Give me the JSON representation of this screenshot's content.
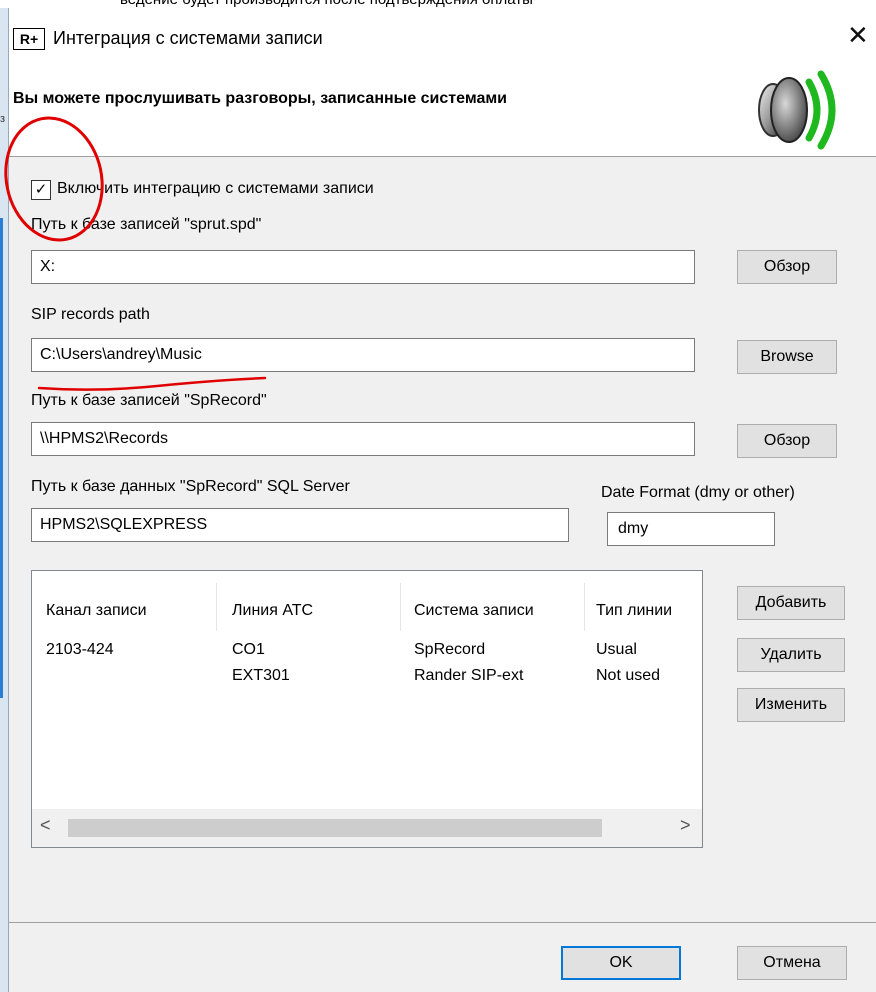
{
  "background_text": "ведение будет производится после подтверждения оплаты",
  "window": {
    "app_icon_text": "R+",
    "title": "Интеграция с системами записи",
    "close_glyph": "✕"
  },
  "banner": {
    "text": "Вы можете прослушивать разговоры, записанные системами"
  },
  "integration_checkbox": {
    "checked": true,
    "check_glyph": "✓",
    "label": "Включить интеграцию с системами записи"
  },
  "sprut": {
    "label": "Путь к базе записей \"sprut.spd\"",
    "value": "X:",
    "button": "Обзор"
  },
  "sip": {
    "label": "SIP records path",
    "value": "C:\\Users\\andrey\\Music",
    "button": "Browse"
  },
  "sprecord": {
    "label": "Путь к базе записей \"SpRecord\"",
    "value": "\\\\HPMS2\\Records",
    "button": "Обзор"
  },
  "sql": {
    "label": "Путь к базе данных \"SpRecord\" SQL Server",
    "value": "HPMS2\\SQLEXPRESS"
  },
  "date_format": {
    "label": "Date Format (dmy or other)",
    "value": "dmy"
  },
  "list": {
    "columns": [
      "Канал записи",
      "Линия АТС",
      "Система записи",
      "Тип линии"
    ],
    "rows": [
      [
        "2103-424",
        "CO1",
        "SpRecord",
        "Usual"
      ],
      [
        "",
        "EXT301",
        "Rander SIP-ext",
        "Not used"
      ]
    ],
    "scroll_left": "<",
    "scroll_right": ">"
  },
  "side_buttons": {
    "add": "Добавить",
    "delete": "Удалить",
    "edit": "Изменить"
  },
  "footer": {
    "ok": "OK",
    "cancel": "Отмена"
  },
  "colors": {
    "annotation": "#e00000",
    "speaker_wave": "#1fb81f",
    "default_button_border": "#0078d7"
  },
  "icons": {
    "speaker": "speaker-sound-icon",
    "app": "r-plus-app-icon"
  }
}
